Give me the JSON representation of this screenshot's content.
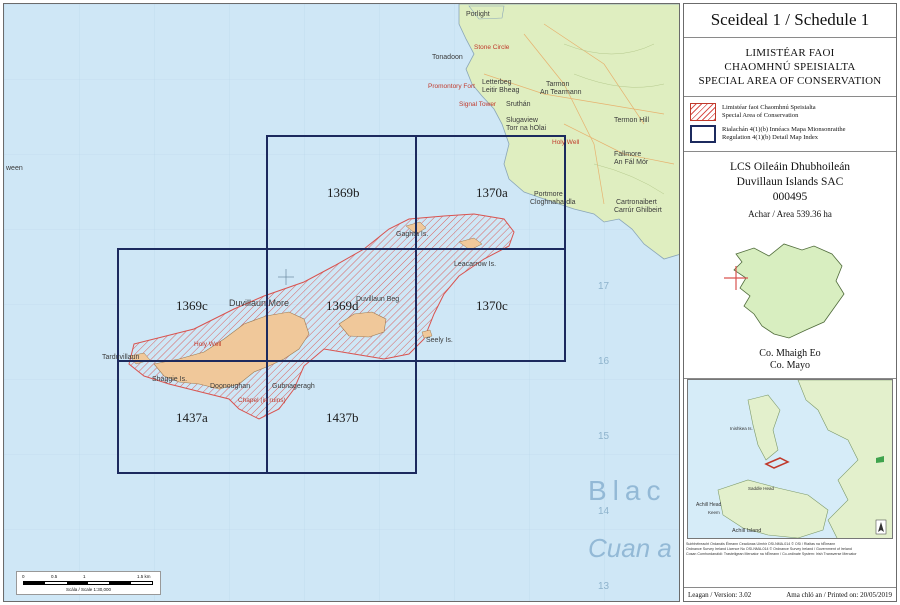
{
  "schedule_title": "Sceideal 1 / Schedule 1",
  "designation": {
    "line1": "LIMISTÉAR FAOI",
    "line2": "CHAOMHNÚ SPEISIALTA",
    "line3": "SPECIAL AREA OF CONSERVATION"
  },
  "legend": {
    "sac_ga": "Limistéar faoi Chaomhnú Speisialta",
    "sac_en": "Special Area of Conservation",
    "index_ga": "Rialachán 4(1)(b) Innéacs Mapa Mionsonraithe",
    "index_en": "Regulation 4(1)(b) Detail Map Index"
  },
  "site": {
    "name_ga": "LCS Oileáin Dhubhoileán",
    "name_en": "Duvillaun Islands SAC",
    "code": "000495",
    "area": "Achar / Area 539.36 ha"
  },
  "county": {
    "ga": "Co. Mhaigh Eo",
    "en": "Co. Mayo"
  },
  "credits": {
    "line1": "Suirbhéireacht Ordanáis Éireann Ceadúnas Uimhir OSi-NMA-014 © OSi / Rialtas na hÉireann",
    "line2": "Ordnance Survey Ireland Licence No OSI-NMA-014 © Ordnance Survey Ireland / Government of Ireland",
    "line3": "Cosan Comhordanáidí: Trasteilgean Mercator na hÉireann / Co-ordinate System: Irish Transverse Mercator"
  },
  "footer": {
    "version": "Leagan / Version: 3.02",
    "printed": "Ama chló an / Printed on: 20/05/2019"
  },
  "scale": {
    "ticks": [
      "0",
      "0.5",
      "1",
      "1.5 km"
    ],
    "label": "Scála / Scale 1:30,000"
  },
  "tiles": [
    "1369b",
    "1370a",
    "1369c",
    "1369d",
    "1370c",
    "1437a",
    "1437b"
  ],
  "grid_numbers": [
    "17",
    "16",
    "15",
    "14",
    "13"
  ],
  "map_labels": {
    "porlight": "Porlight",
    "tonadoon": "Tonadoon",
    "stone_circle": "Stone Circle",
    "letterbeg": "Letterbeg",
    "leitir_bheag": "Leitir Bheag",
    "promontory_fort": "Promontory Fort",
    "signal_tower": "Signal Tower",
    "sruthan": "Sruthán",
    "slugaview": "Slugaview",
    "torr_na_hoilai": "Torr na hOlai",
    "tarmon": "Tarmon",
    "an_tearmann": "An Tearmann",
    "termon_hill": "Termon Hill",
    "holy_well": "Holy Well",
    "fallmore": "Fallmore",
    "an_fal_mor": "An Fál Mór",
    "portmore": "Portmore",
    "cloghnahardla": "Cloghnahardla",
    "cartronaibert": "Cartronaibert",
    "carrur_ghilbeirt": "Carrúr Ghilbeirt",
    "gaghta": "Gaghta Is.",
    "leacarrow": "Leacarrow Is.",
    "duvillaun_more": "Duvillaun More",
    "duvillaun_beg": "Duvillaun Beg",
    "seely": "Seely Is.",
    "tarduvillaun": "Tarduvillaun",
    "shaggie": "Shaggie Is.",
    "doonoughan": "Doonoughan",
    "gubnageragh": "Gubnageragh",
    "holy_well_2": "Holy Well",
    "chapel": "Chapel (in ruins)",
    "ween": "ween",
    "blacksod": "Blac",
    "cuan": "Cuan a"
  },
  "inset_labels": {
    "achill_head": "Achill Head",
    "achill_island": "Achill Island",
    "inishkea": "Inishkea Is.",
    "saddle_head": "Saddle Head",
    "keem": "Keem"
  },
  "colors": {
    "sea": "#cfe7f6",
    "land": "#dfeec0",
    "island": "#f0c89a",
    "sac_hatch": "#d9534f",
    "tile_border": "#1c2a5e",
    "county_fill": "#d8eec0"
  }
}
